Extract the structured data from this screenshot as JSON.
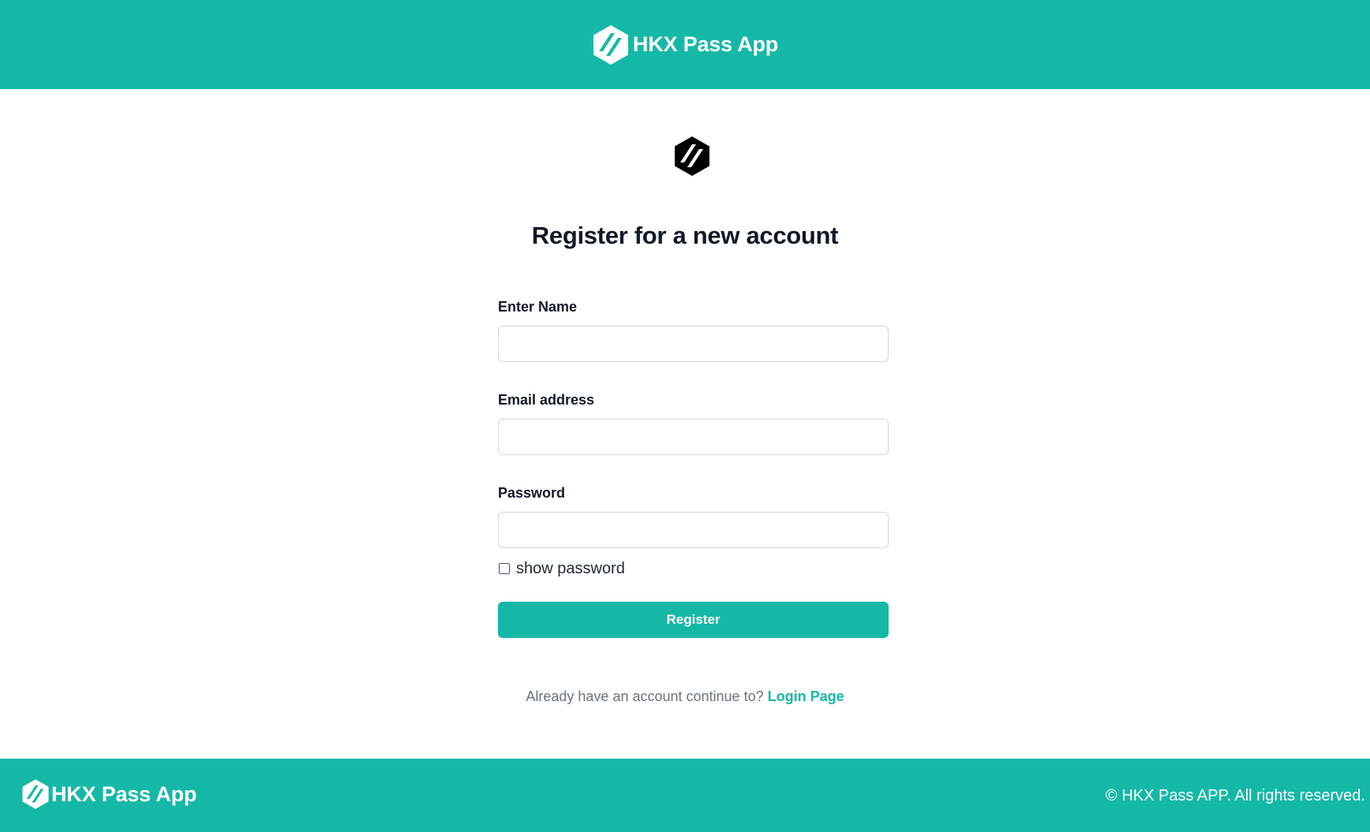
{
  "header": {
    "brand_name": "HKX Pass App",
    "logo_icon": "hexagon-slash-logo-icon"
  },
  "main": {
    "logo_icon": "hexagon-slash-logo-icon",
    "title": "Register for a new account",
    "form": {
      "name_label": "Enter Name",
      "name_value": "",
      "email_label": "Email address",
      "email_value": "",
      "password_label": "Password",
      "password_value": "",
      "show_password_label": "show password",
      "show_password_checked": false,
      "submit_label": "Register"
    },
    "login_prompt": "Already have an account continue to?",
    "login_link": "Login Page"
  },
  "footer": {
    "brand_name": "HKX Pass App",
    "copyright": "© HKX Pass APP. All rights reserved."
  },
  "colors": {
    "brand": "#15b8a6",
    "text": "#111827",
    "muted": "#6b7280"
  }
}
